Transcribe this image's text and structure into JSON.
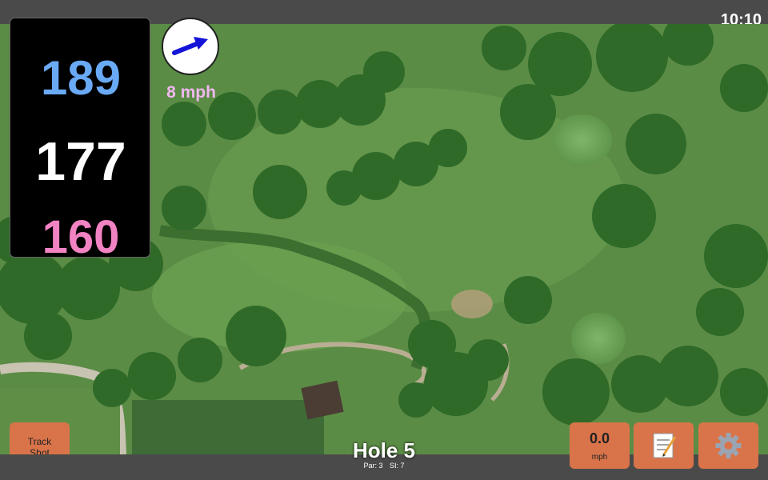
{
  "status_bar": {
    "time": "10:10"
  },
  "distances": {
    "back": "189",
    "middle": "177",
    "front": "160"
  },
  "wind": {
    "speed_label": "8 mph",
    "direction": "arrow pointing east-northeast"
  },
  "hole": {
    "title": "Hole 5",
    "par": "Par: 3",
    "stroke_index": "SI: 7"
  },
  "buttons": {
    "track_shot_line1": "Track",
    "track_shot_line2": "Shot",
    "wind_value": "0.0",
    "wind_unit": "mph",
    "notes_icon": "notepad-icon",
    "settings_icon": "gear-icon"
  },
  "colors": {
    "back_distance": "#6aaaf5",
    "middle_distance": "#ffffff",
    "front_distance": "#f283c3",
    "wind_text": "#f2b8f2",
    "button_bg": "#d9744a",
    "wind_arrow": "#1414d8",
    "chrome": "#4a4a4a"
  }
}
